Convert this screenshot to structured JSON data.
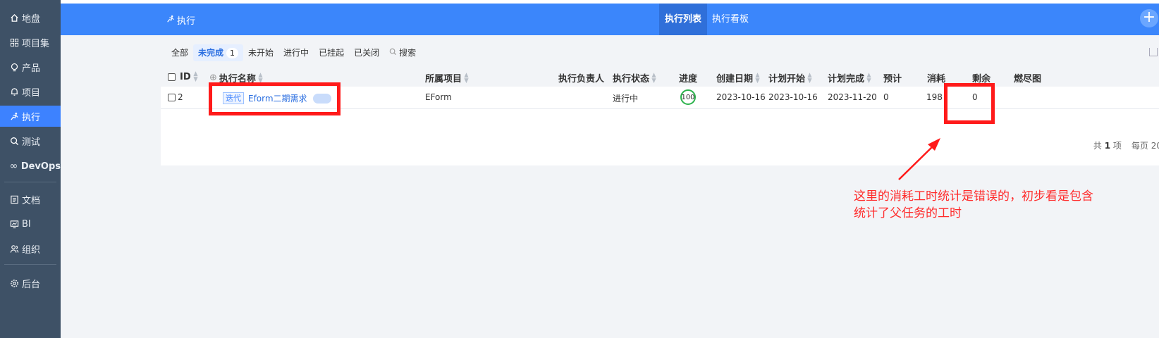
{
  "sidebar": {
    "items": [
      {
        "label": "地盘",
        "icon": "home-icon"
      },
      {
        "label": "项目集",
        "icon": "grid-icon"
      },
      {
        "label": "产品",
        "icon": "bulb-icon"
      },
      {
        "label": "项目",
        "icon": "bell-icon"
      },
      {
        "label": "执行",
        "icon": "run-icon",
        "active": true
      },
      {
        "label": "测试",
        "icon": "search-check-icon"
      },
      {
        "label": "DevOps",
        "icon": "infinity-icon"
      },
      {
        "label": "文档",
        "icon": "doc-icon"
      },
      {
        "label": "BI",
        "icon": "monitor-icon"
      },
      {
        "label": "组织",
        "icon": "people-icon"
      },
      {
        "label": "后台",
        "icon": "gear-icon"
      }
    ]
  },
  "header": {
    "breadcrumb": "执行",
    "tabs": [
      {
        "label": "执行列表",
        "active": true
      },
      {
        "label": "执行看板",
        "active": false
      }
    ],
    "plus_icon": "+"
  },
  "filters": {
    "items": [
      {
        "label": "全部"
      },
      {
        "label": "未完成",
        "badge": "1",
        "active": true
      },
      {
        "label": "未开始"
      },
      {
        "label": "进行中"
      },
      {
        "label": "已挂起"
      },
      {
        "label": "已关闭"
      }
    ],
    "search_label": "搜索"
  },
  "table": {
    "columns": [
      "ID",
      "执行名称",
      "所属项目",
      "执行负责人",
      "执行状态",
      "进度",
      "创建日期",
      "计划开始",
      "计划完成",
      "预计",
      "消耗",
      "剩余",
      "燃尽图"
    ],
    "rows": [
      {
        "id": "2",
        "tag": "迭代",
        "name": "Eform二期需求",
        "project": "EForm",
        "owner": "",
        "status": "进行中",
        "progress": "100",
        "created": "2023-10-16",
        "plan_start": "2023-10-16",
        "plan_end": "2023-11-20",
        "estimate": "0",
        "consumed": "198",
        "left": "0"
      }
    ],
    "pager": {
      "total_prefix": "共",
      "total": "1",
      "total_suffix": "项",
      "per_page": "每页 20"
    }
  },
  "annotation": {
    "line1": "这里的消耗工时统计是错误的，初步看是包含",
    "line2": "统计了父任务的工时",
    "color": "#ff1a1a"
  }
}
